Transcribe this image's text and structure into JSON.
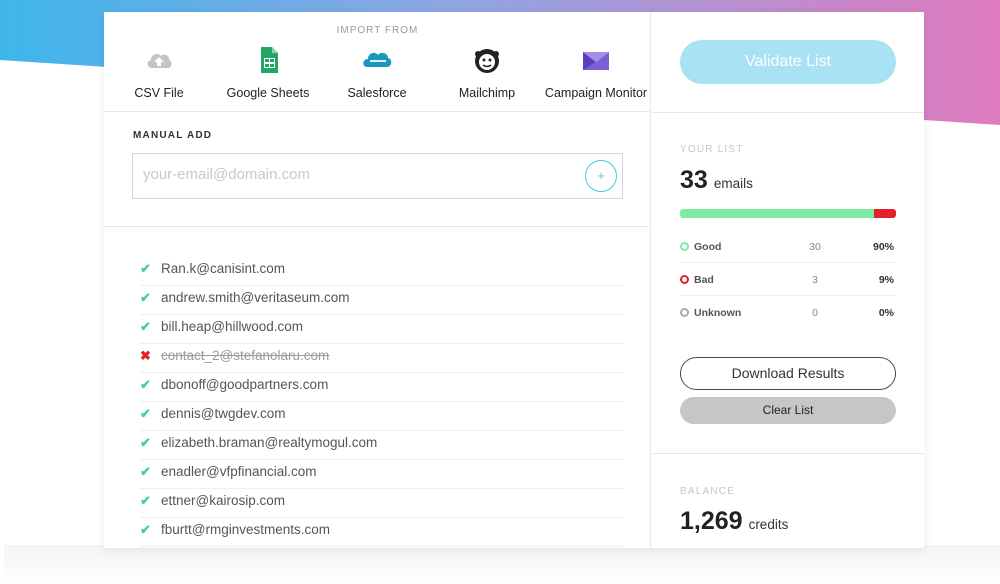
{
  "import": {
    "title": "IMPORT FROM",
    "sources": [
      {
        "label": "CSV File",
        "icon": "cloud-upload-icon"
      },
      {
        "label": "Google Sheets",
        "icon": "google-sheets-icon"
      },
      {
        "label": "Salesforce",
        "icon": "salesforce-icon"
      },
      {
        "label": "Mailchimp",
        "icon": "mailchimp-icon"
      },
      {
        "label": "Campaign Monitor",
        "icon": "campaign-monitor-icon"
      }
    ]
  },
  "manual": {
    "title": "MANUAL ADD",
    "placeholder": "your-email@domain.com",
    "add_symbol": "+"
  },
  "emails": [
    {
      "address": "Ran.k@canisint.com",
      "status": "good"
    },
    {
      "address": "andrew.smith@veritaseum.com",
      "status": "good"
    },
    {
      "address": "bill.heap@hillwood.com",
      "status": "good"
    },
    {
      "address": "contact_2@stefanolaru.com",
      "status": "bad"
    },
    {
      "address": "dbonoff@goodpartners.com",
      "status": "good"
    },
    {
      "address": "dennis@twgdev.com",
      "status": "good"
    },
    {
      "address": "elizabeth.braman@realtymogul.com",
      "status": "good"
    },
    {
      "address": "enadler@vfpfinancial.com",
      "status": "good"
    },
    {
      "address": "ettner@kairosip.com",
      "status": "good"
    },
    {
      "address": "fburtt@rmginvestments.com",
      "status": "good"
    }
  ],
  "sidebar": {
    "validate_label": "Validate List",
    "your_list_title": "YOUR LIST",
    "count": "33",
    "count_unit": "emails",
    "good_fraction": 0.9,
    "bad_fraction": 0.09,
    "stats": [
      {
        "name": "Good",
        "count": "30",
        "pct": "90%",
        "color": "#7ee8a5"
      },
      {
        "name": "Bad",
        "count": "3",
        "pct": "9%",
        "color": "#e0232b"
      },
      {
        "name": "Unknown",
        "count": "0",
        "pct": "0%",
        "color": "#a9a9b0"
      }
    ],
    "download_label": "Download Results",
    "clear_label": "Clear List",
    "balance_title": "BALANCE",
    "balance": "1,269",
    "balance_unit": "credits"
  },
  "colors": {
    "accent": "#48c9e4",
    "validate_bg": "#a9e3f3",
    "good": "#49d18c",
    "bad": "#e0232b"
  }
}
